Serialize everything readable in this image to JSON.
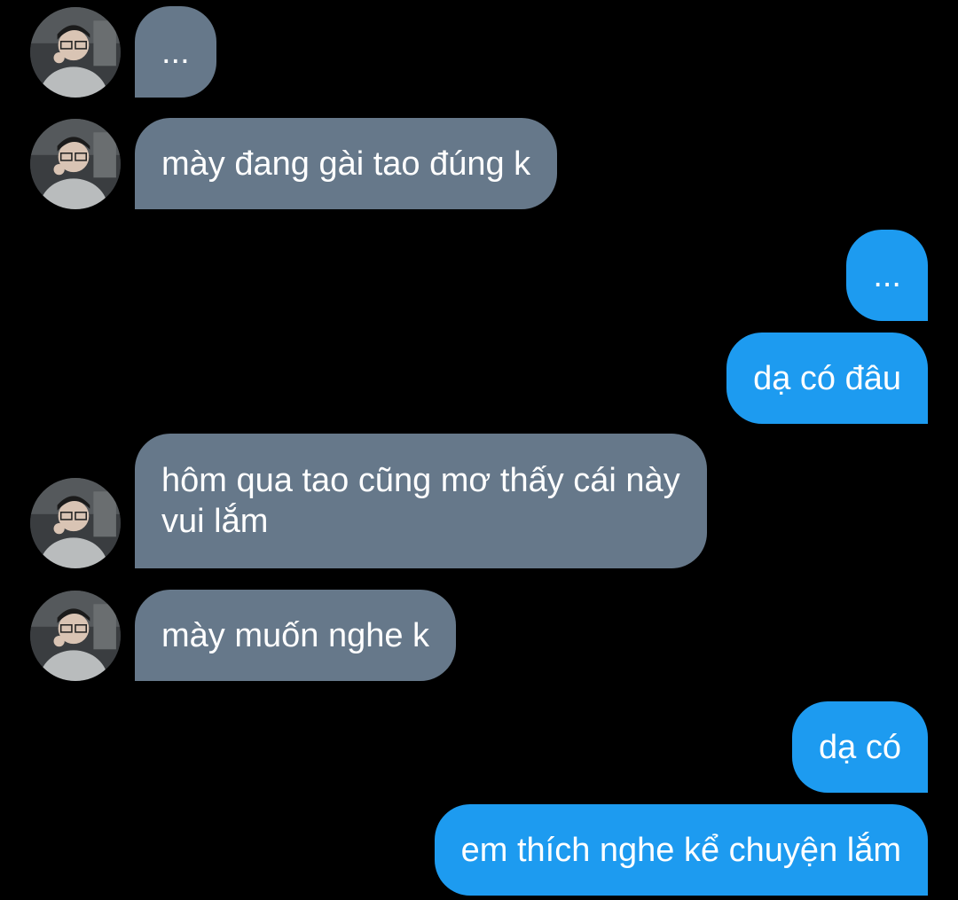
{
  "colors": {
    "background": "#000000",
    "received_bubble": "#66788a",
    "sent_bubble": "#1d9bf0",
    "text": "#ffffff"
  },
  "messages": [
    {
      "side": "received",
      "text": "..."
    },
    {
      "side": "received",
      "text": "mày đang gài tao đúng k"
    },
    {
      "side": "sent",
      "text": "..."
    },
    {
      "side": "sent",
      "text": "dạ có đâu"
    },
    {
      "side": "received",
      "lines": [
        "hôm qua tao cũng mơ thấy cái này",
        "vui lắm"
      ]
    },
    {
      "side": "received",
      "text": "mày muốn nghe k"
    },
    {
      "side": "sent",
      "text": "dạ có"
    },
    {
      "side": "sent",
      "text": "em thích nghe kể chuyện lắm"
    }
  ]
}
